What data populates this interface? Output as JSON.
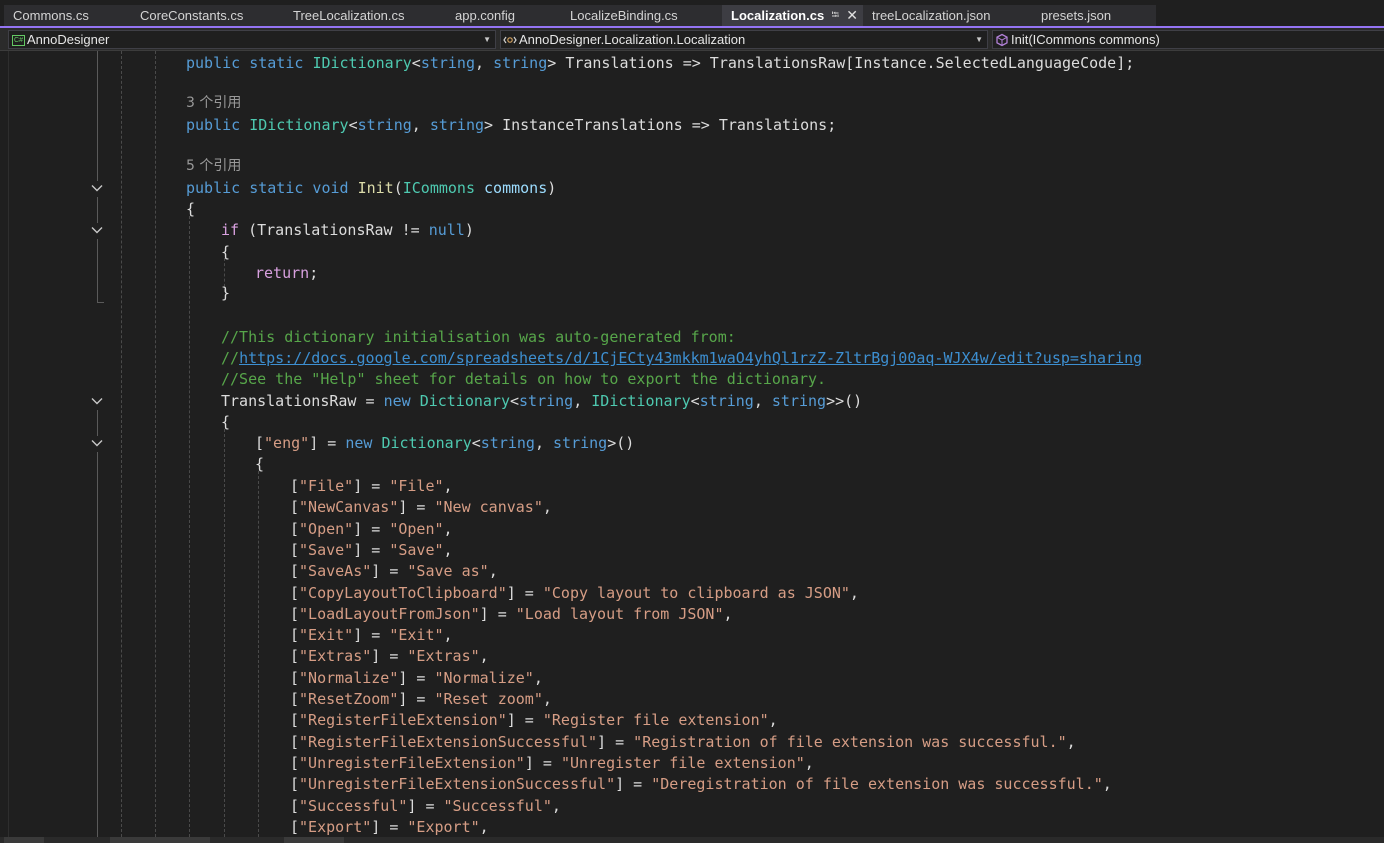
{
  "tabs": [
    {
      "label": "Commons.cs"
    },
    {
      "label": "CoreConstants.cs"
    },
    {
      "label": "TreeLocalization.cs"
    },
    {
      "label": "app.config"
    },
    {
      "label": "LocalizeBinding.cs"
    },
    {
      "label": "Localization.cs",
      "active": true
    },
    {
      "label": "treeLocalization.json"
    },
    {
      "label": "presets.json"
    }
  ],
  "navbar": {
    "project": "AnnoDesigner",
    "type": "AnnoDesigner.Localization.Localization",
    "member": "Init(ICommons commons)"
  },
  "refs": [
    "3 个引用",
    "5 个引用"
  ],
  "colors": {
    "accent": "#9474f4",
    "keyword": "#569cd6",
    "control_keyword": "#d8a0df",
    "type": "#4ec9b0",
    "string": "#d69d85",
    "comment": "#57a64a"
  },
  "code": {
    "translations_prop": "Translations => TranslationsRaw[Instance.SelectedLanguageCode];",
    "instance_translations": "InstanceTranslations => Translations;",
    "init_method": "Init",
    "init_param_type": "ICommons",
    "init_param": "commons",
    "comment_1": "//This dictionary initialisation was auto-generated from:",
    "comment_url_prefix": "//",
    "comment_url": "https://docs.google.com/spreadsheets/d/1CjECty43mkkm1waO4yhQl1rzZ-ZltrBgj00aq-WJX4w/edit?usp=sharing",
    "comment_3": "//See the \"Help\" sheet for details on how to export the dictionary.",
    "lang_key": "\"eng\"",
    "entries": [
      {
        "key": "\"File\"",
        "value": "\"File\""
      },
      {
        "key": "\"NewCanvas\"",
        "value": "\"New canvas\""
      },
      {
        "key": "\"Open\"",
        "value": "\"Open\""
      },
      {
        "key": "\"Save\"",
        "value": "\"Save\""
      },
      {
        "key": "\"SaveAs\"",
        "value": "\"Save as\""
      },
      {
        "key": "\"CopyLayoutToClipboard\"",
        "value": "\"Copy layout to clipboard as JSON\""
      },
      {
        "key": "\"LoadLayoutFromJson\"",
        "value": "\"Load layout from JSON\""
      },
      {
        "key": "\"Exit\"",
        "value": "\"Exit\""
      },
      {
        "key": "\"Extras\"",
        "value": "\"Extras\""
      },
      {
        "key": "\"Normalize\"",
        "value": "\"Normalize\""
      },
      {
        "key": "\"ResetZoom\"",
        "value": "\"Reset zoom\""
      },
      {
        "key": "\"RegisterFileExtension\"",
        "value": "\"Register file extension\""
      },
      {
        "key": "\"RegisterFileExtensionSuccessful\"",
        "value": "\"Registration of file extension was successful.\""
      },
      {
        "key": "\"UnregisterFileExtension\"",
        "value": "\"Unregister file extension\""
      },
      {
        "key": "\"UnregisterFileExtensionSuccessful\"",
        "value": "\"Deregistration of file extension was successful.\""
      },
      {
        "key": "\"Successful\"",
        "value": "\"Successful\""
      },
      {
        "key": "\"Export\"",
        "value": "\"Export\""
      }
    ]
  }
}
